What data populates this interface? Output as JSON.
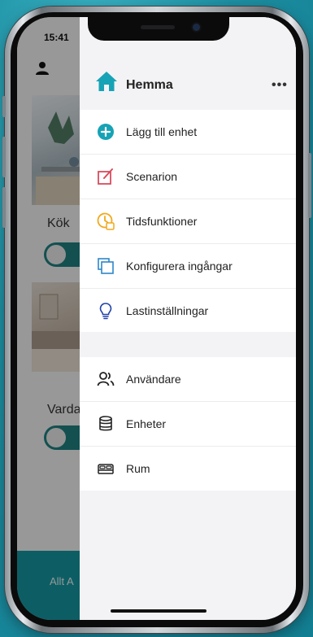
{
  "status": {
    "time": "15:41"
  },
  "background_app": {
    "rooms": [
      {
        "label": "Kök",
        "toggle_on": true
      },
      {
        "label": "Varda",
        "toggle_on": true
      }
    ],
    "bottom_bar_text": "Allt A"
  },
  "drawer": {
    "title": "Hemma",
    "more_label": "•••",
    "section1": [
      {
        "label": "Lägg till enhet",
        "icon": "add-circle-icon"
      },
      {
        "label": "Scenarion",
        "icon": "edit-note-icon"
      },
      {
        "label": "Tidsfunktioner",
        "icon": "clock-icon"
      },
      {
        "label": "Konfigurera ingångar",
        "icon": "copy-icon"
      },
      {
        "label": "Lastinställningar",
        "icon": "bulb-icon"
      }
    ],
    "section2": [
      {
        "label": "Användare",
        "icon": "users-icon"
      },
      {
        "label": "Enheter",
        "icon": "database-icon"
      },
      {
        "label": "Rum",
        "icon": "bed-icon"
      }
    ]
  },
  "colors": {
    "accent": "#16a3b5",
    "edit_red": "#d94c5e",
    "clock_orange": "#f1a91c",
    "icon_blue": "#2e86c9",
    "bottom_bar": "#15959e"
  }
}
